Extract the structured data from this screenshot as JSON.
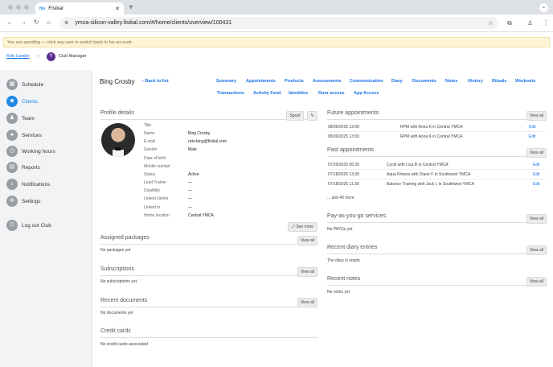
{
  "browser": {
    "tab_title": "Fisikal",
    "favicon": "fisi",
    "url": "ymca-silicon-valley.fisikal.com/#/home/clients/overview/100431"
  },
  "banner": {
    "text": "You are spoofing — click any user to switch back to his account"
  },
  "breadcrumb": {
    "user": "Rob Lander",
    "separator": ">",
    "role": "Club Manager"
  },
  "sidebar": {
    "items": [
      {
        "label": "Schedule",
        "icon": "calendar-icon"
      },
      {
        "label": "Clients",
        "icon": "clients-icon",
        "active": true
      },
      {
        "label": "Team",
        "icon": "team-icon"
      },
      {
        "label": "Services",
        "icon": "services-icon"
      },
      {
        "label": "Working hours",
        "icon": "clock-icon"
      },
      {
        "label": "Reports",
        "icon": "reports-icon"
      },
      {
        "label": "Notifications",
        "icon": "bell-icon"
      },
      {
        "label": "Settings",
        "icon": "gear-icon"
      },
      {
        "label": "Log out Club",
        "icon": "logout-icon"
      }
    ]
  },
  "client": {
    "name": "Bing Crosby",
    "back": "Back to list"
  },
  "nav": {
    "row1": [
      "Summary",
      "Appointments",
      "Products",
      "Assessments",
      "Communication",
      "Diary",
      "Documents",
      "Notes",
      "History",
      "Rituals",
      "Workouts"
    ],
    "row2": [
      "Transactions",
      "Activity Feed",
      "Identities",
      "Door access",
      "App Access"
    ]
  },
  "profile": {
    "title": "Profile details",
    "spoof": "Spoof",
    "see_more": "See more",
    "fields": [
      {
        "label": "Title",
        "value": ""
      },
      {
        "label": "Name",
        "value": "Bing Crosby"
      },
      {
        "label": "E-mail",
        "value": "rob+bing@fisikal.com"
      },
      {
        "label": "Gender",
        "value": "Male"
      },
      {
        "label": "Date of birth",
        "value": ""
      },
      {
        "label": "Mobile number",
        "value": ""
      },
      {
        "label": "Status",
        "value": "Active"
      },
      {
        "label": "Lead Trainer",
        "value": "—"
      },
      {
        "label": "Disability",
        "value": "—"
      },
      {
        "label": "Linked clients",
        "value": "—"
      },
      {
        "label": "Linked to",
        "value": "—"
      },
      {
        "label": "Home location",
        "value": "Central YMCA"
      }
    ]
  },
  "packages": {
    "title": "Assigned packages",
    "view_all": "View all",
    "empty": "No packages yet"
  },
  "subscriptions": {
    "title": "Subscriptions",
    "view_all": "View all",
    "empty": "No subscriptions yet"
  },
  "documents": {
    "title": "Recent documents",
    "view_all": "View all",
    "empty": "No documents yet"
  },
  "credit_cards": {
    "title": "Credit cards",
    "empty": "No credit cards associated"
  },
  "future": {
    "title": "Future appointments",
    "view_all": "View all",
    "edit": "Edit",
    "rows": [
      {
        "date": "08/06/2025 13:00",
        "desc": "RPM with Anna K in Central YMCA"
      },
      {
        "date": "08/06/2025 13:00",
        "desc": "RPM with Anna K in Central YMCA"
      }
    ]
  },
  "past": {
    "title": "Past appointments",
    "view_all": "View all",
    "edit": "Edit",
    "more": "... and 40 more",
    "rows": [
      {
        "date": "07/29/2025 06:30",
        "desc": "Cycle with Lisa B in Central YMCA"
      },
      {
        "date": "07/18/2025 13:30",
        "desc": "Aqua Fitness with Diane F in Southwest YMCA"
      },
      {
        "date": "07/18/2025 11:30",
        "desc": "Balance Training with Jack L in Southwest YMCA"
      }
    ]
  },
  "payg": {
    "title": "Pay-as-you-go services",
    "view_all": "View all",
    "empty": "No PAYGs yet"
  },
  "diary": {
    "title": "Recent diary entries",
    "view_all": "View all",
    "empty": "The diary is empty"
  },
  "notes": {
    "title": "Recent notes",
    "view_all": "View all",
    "empty": "No notes yet"
  },
  "colors": {
    "accent": "#1e88e5",
    "link": "#1a73e8",
    "banner": "#fdf5d6"
  }
}
